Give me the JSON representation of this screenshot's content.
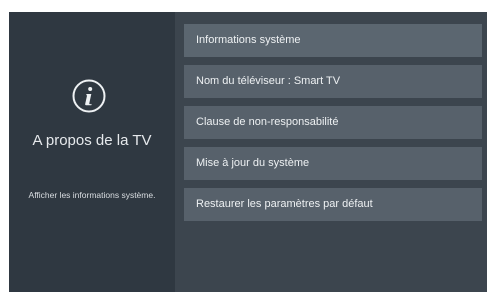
{
  "left_panel": {
    "icon": "info-circle-icon",
    "title": "A propos de la TV",
    "description": "Afficher les informations système."
  },
  "menu": {
    "items": [
      {
        "label": "Informations système"
      },
      {
        "label": "Nom du téléviseur : Smart TV"
      },
      {
        "label": "Clause de non-responsabilité"
      },
      {
        "label": "Mise à jour du système"
      },
      {
        "label": "Restaurer les paramètres par défaut"
      }
    ]
  },
  "colors": {
    "screen_bg": "#3b444d",
    "left_panel_bg": "#2f3841",
    "menu_item_bg": "#57616b",
    "text": "#eef1f3"
  }
}
